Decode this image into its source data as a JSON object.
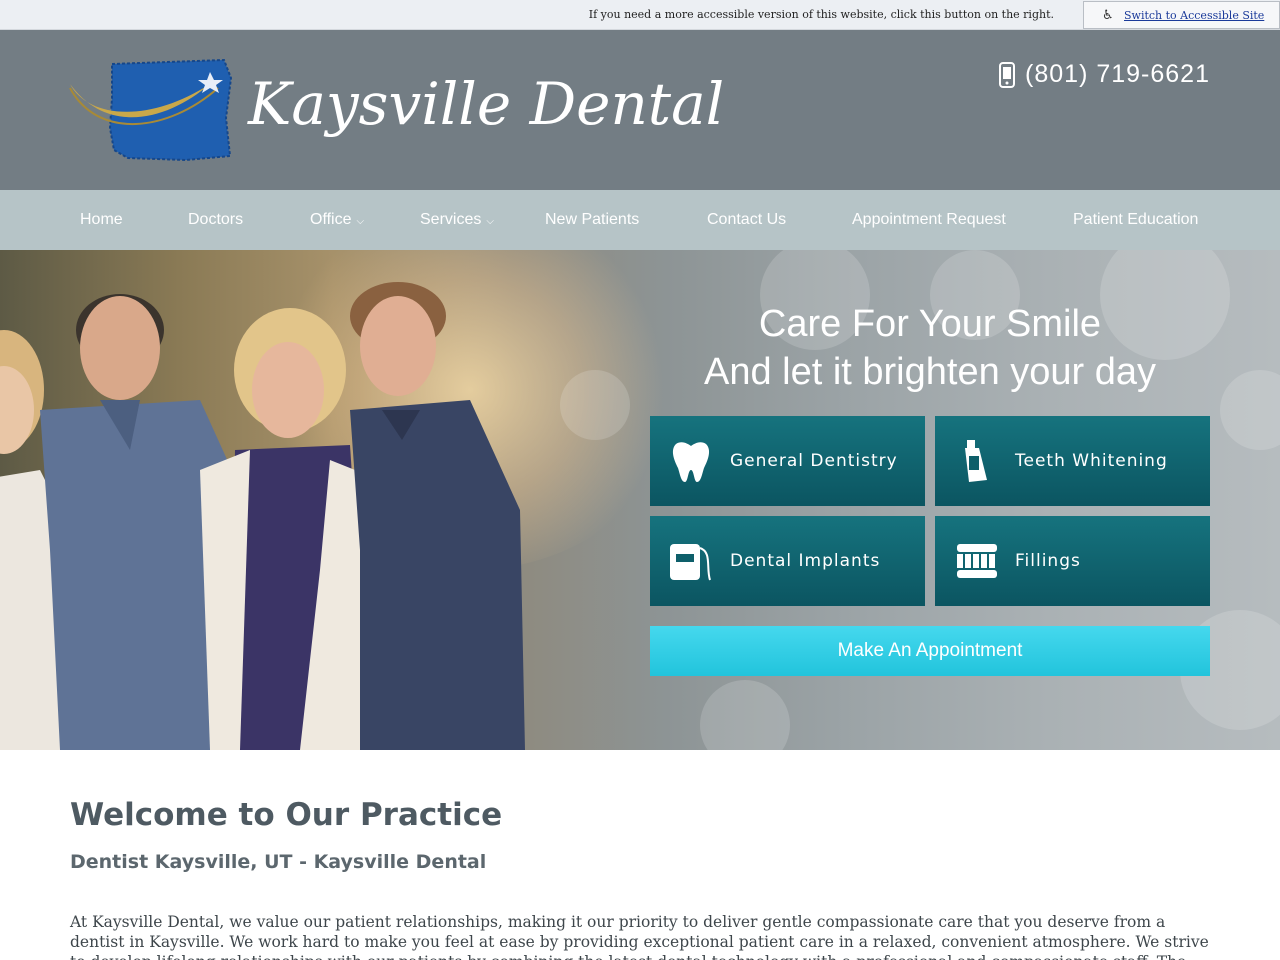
{
  "accessibility": {
    "notice": "If you need a more accessible version of this website, click this button on the right.",
    "link_label": "Switch to Accessible Site"
  },
  "header": {
    "logo_text": "Kaysville Dental",
    "phone": "(801) 719-6621"
  },
  "nav": {
    "items": [
      {
        "label": "Home",
        "has_dropdown": false
      },
      {
        "label": "Doctors",
        "has_dropdown": false
      },
      {
        "label": "Office",
        "has_dropdown": true
      },
      {
        "label": "Services",
        "has_dropdown": true
      },
      {
        "label": "New Patients",
        "has_dropdown": false
      },
      {
        "label": "Contact Us",
        "has_dropdown": false
      },
      {
        "label": "Appointment Request",
        "has_dropdown": false
      },
      {
        "label": "Patient Education",
        "has_dropdown": false
      }
    ]
  },
  "hero": {
    "title_line1": "Care For Your Smile",
    "title_line2": "And let it brighten your day",
    "services": [
      {
        "label": "General Dentistry",
        "icon": "tooth-icon"
      },
      {
        "label": "Teeth Whitening",
        "icon": "whitening-tube-icon"
      },
      {
        "label": "Dental Implants",
        "icon": "floss-icon"
      },
      {
        "label": "Fillings",
        "icon": "toothbrush-icon"
      }
    ],
    "cta_label": "Make An Appointment"
  },
  "content": {
    "heading": "Welcome to Our Practice",
    "subheading": "Dentist Kaysville, UT - Kaysville Dental",
    "intro": "At Kaysville Dental, we value our patient relationships, making it our priority to deliver gentle compassionate care that you deserve from a dentist in Kaysville. We work hard to make you feel at ease by providing exceptional patient care in a relaxed, convenient atmosphere. We strive to develop lifelong relationships with our patients by combining the latest dental technology with a professional and compassionate staff. The result is a beautiful, healthy smile that lasts a lifetime."
  },
  "colors": {
    "header_bg": "#737d84",
    "nav_bg": "#b6c4c7",
    "service_card": "#0e5f6a",
    "cta": "#2ecbe2",
    "logo_blue": "#1f5fb0",
    "logo_gold": "#c9a84a"
  }
}
